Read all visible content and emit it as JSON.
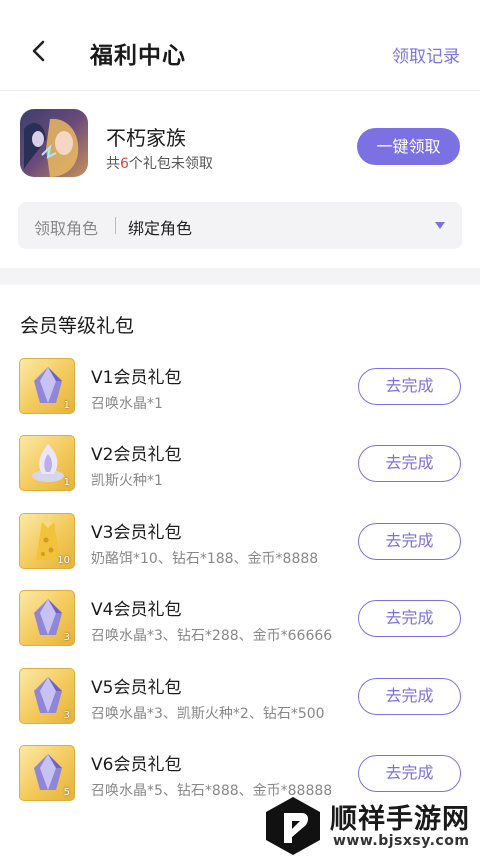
{
  "header": {
    "title": "福利中心",
    "records_label": "领取记录"
  },
  "game": {
    "name": "不朽家族",
    "pending_prefix": "共",
    "pending_count": "6",
    "pending_suffix": "个礼包未领取",
    "claim_all_label": "一键领取",
    "role_label": "领取角色",
    "role_value": "绑定角色"
  },
  "section": {
    "title": "会员等级礼包",
    "gifts": [
      {
        "name": "V1会员礼包",
        "items": "召唤水晶*1",
        "icon": "purple-crystal-icon",
        "badge": "1",
        "button": "去完成"
      },
      {
        "name": "V2会员礼包",
        "items": "凯斯火种*1",
        "icon": "flame-seed-icon",
        "badge": "1",
        "button": "去完成"
      },
      {
        "name": "V3会员礼包",
        "items": "奶酪饵*10、钻石*188、金币*8888",
        "icon": "cheese-bait-icon",
        "badge": "10",
        "button": "去完成"
      },
      {
        "name": "V4会员礼包",
        "items": "召唤水晶*3、钻石*288、金币*66666",
        "icon": "purple-crystal-icon",
        "badge": "3",
        "button": "去完成"
      },
      {
        "name": "V5会员礼包",
        "items": "召唤水晶*3、凯斯火种*2、钻石*500",
        "icon": "purple-crystal-icon",
        "badge": "3",
        "button": "去完成"
      },
      {
        "name": "V6会员礼包",
        "items": "召唤水晶*5、钻石*888、金币*88888",
        "icon": "purple-crystal-icon",
        "badge": "5",
        "button": "去完成"
      }
    ]
  },
  "watermark": {
    "name": "顺祥手游网",
    "url": "www.bjsxsy.com"
  },
  "colors": {
    "accent": "#7c71e2",
    "highlight": "#e0443b"
  }
}
